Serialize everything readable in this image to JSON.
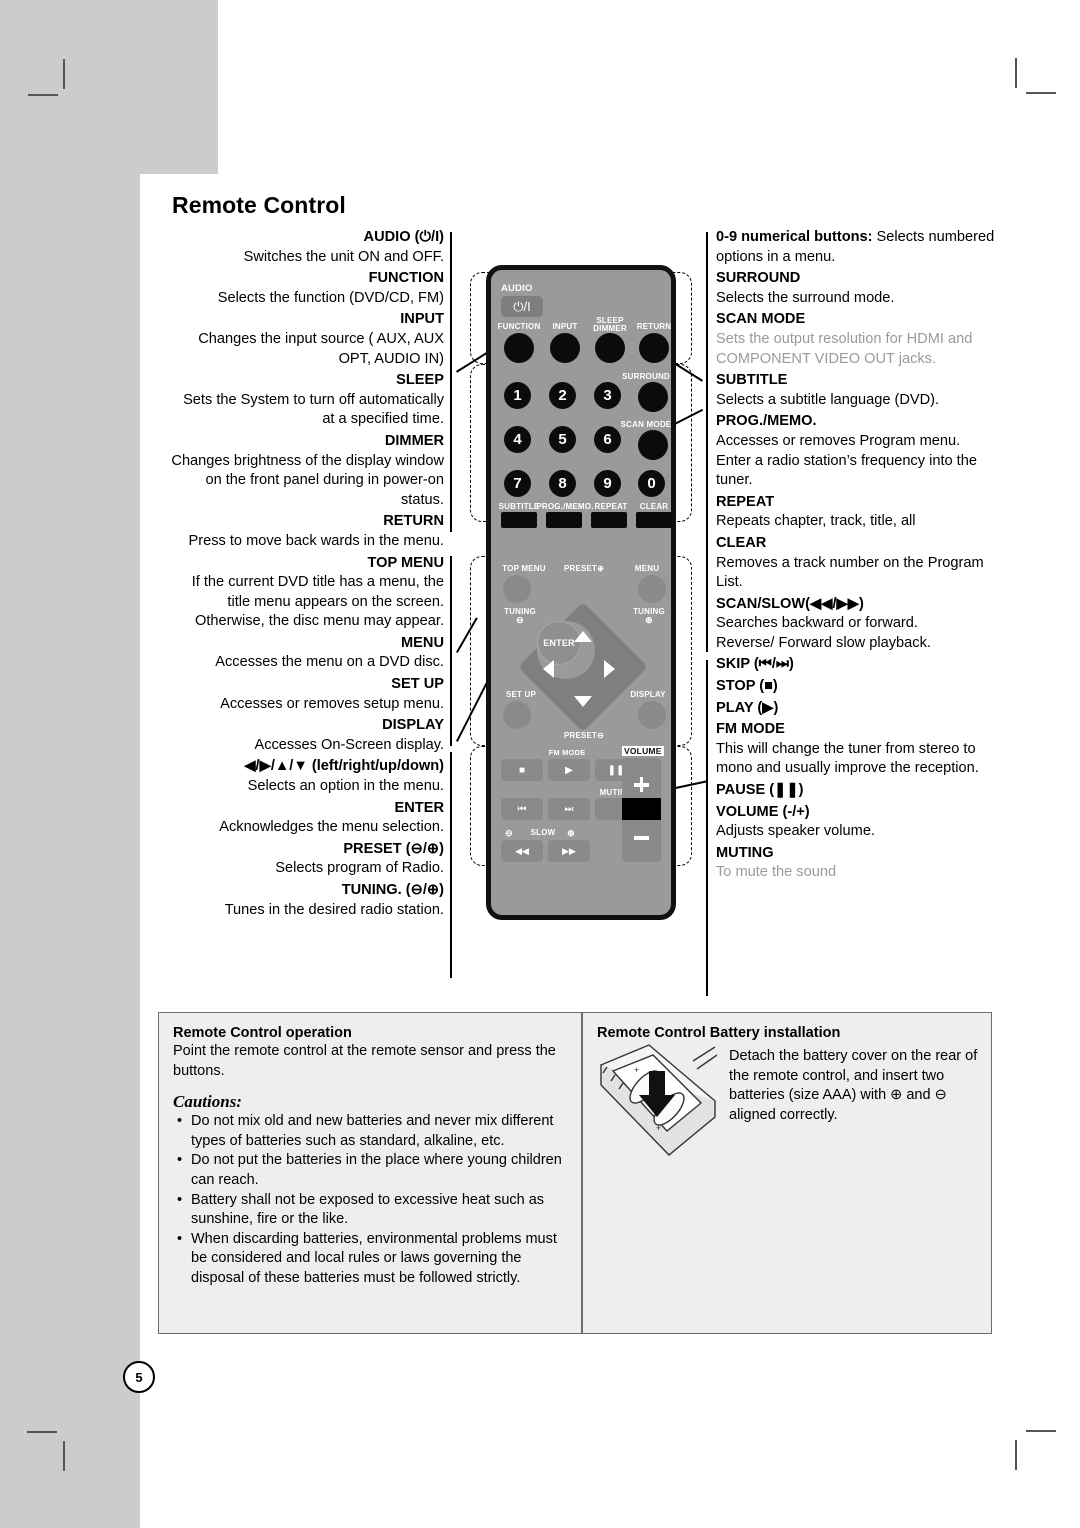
{
  "page": {
    "number": "5"
  },
  "title": "Remote Control",
  "left_column": [
    {
      "head": "AUDIO (⏻/I)",
      "body": "Switches the unit ON and OFF."
    },
    {
      "head": "FUNCTION",
      "body": "Selects the function (DVD/CD, FM)"
    },
    {
      "head": "INPUT",
      "body": "Changes the input source ( AUX, AUX OPT, AUDIO IN)"
    },
    {
      "head": "SLEEP",
      "body": "Sets the System to turn off automatically at a specified time."
    },
    {
      "head": "DIMMER",
      "body": "Changes brightness of the display window on the front panel during in power-on status."
    },
    {
      "head": "RETURN",
      "body": "Press to move back wards in the menu."
    },
    {
      "head": "TOP MENU",
      "body": "If the current DVD title has a menu, the title menu appears on the screen. Otherwise, the disc menu may appear."
    },
    {
      "head": "MENU",
      "body": "Accesses the menu on a DVD disc."
    },
    {
      "head": "SET UP",
      "body": "Accesses or removes setup menu."
    },
    {
      "head": "DISPLAY",
      "body": "Accesses On-Screen display."
    },
    {
      "head": "◀/▶/▲/▼ (left/right/up/down)",
      "body": "Selects an option in the menu."
    },
    {
      "head": "ENTER",
      "body": "Acknowledges the menu selection."
    },
    {
      "head": "PRESET (⊖/⊕)",
      "body": "Selects program of Radio."
    },
    {
      "head": "TUNING. (⊖/⊕)",
      "body": "Tunes in the desired radio station."
    }
  ],
  "right_column": [
    {
      "head": "0-9 numerical buttons:",
      "body": " Selects numbered options in a menu.",
      "inline": true,
      "faded": false
    },
    {
      "head": "SURROUND",
      "body": "Selects the surround mode.",
      "inline": false,
      "faded": false
    },
    {
      "head": "SCAN MODE",
      "body": "Sets the output resolution for HDMI and COMPONENT VIDEO OUT jacks.",
      "inline": false,
      "faded": true
    },
    {
      "head": "SUBTITLE",
      "body": "Selects a subtitle language (DVD).",
      "inline": false,
      "faded": false
    },
    {
      "head": "PROG./MEMO.",
      "body": "Accesses or removes Program menu.\nEnter a radio station’s frequency into the tuner.",
      "inline": false,
      "faded": false
    },
    {
      "head": "REPEAT",
      "body": "Repeats chapter, track, title, all",
      "inline": false,
      "faded": false
    },
    {
      "head": "CLEAR",
      "body": "Removes a track number on the Program List.",
      "inline": false,
      "faded": false
    },
    {
      "head": "SCAN/SLOW(◀◀/▶▶)",
      "body": "Searches backward or forward.\nReverse/ Forward slow playback.",
      "inline": false,
      "faded": false
    },
    {
      "head": "SKIP (⏮/⏭)",
      "body": "",
      "inline": false,
      "faded": false
    },
    {
      "head": "STOP (■)",
      "body": "",
      "inline": false,
      "faded": false
    },
    {
      "head": "PLAY (▶)",
      "body": "",
      "inline": false,
      "faded": false
    },
    {
      "head": "FM MODE",
      "body": "This will change the tuner from stereo to mono and usually improve the reception.",
      "inline": false,
      "faded": false
    },
    {
      "head": "PAUSE (❚❚)",
      "body": "",
      "inline": false,
      "faded": false
    },
    {
      "head": "VOLUME (-/+)",
      "body": "Adjusts speaker volume.",
      "inline": false,
      "faded": false
    },
    {
      "head": "MUTING",
      "body": "To mute the sound",
      "inline": false,
      "faded": true
    }
  ],
  "remote": {
    "labels": {
      "audio": "AUDIO",
      "power": "⏻/I",
      "function": "FUNCTION",
      "input": "INPUT",
      "sleep": "SLEEP",
      "dimmer": "DIMMER",
      "return": "RETURN",
      "surround": "SURROUND",
      "scan_mode": "SCAN MODE",
      "subtitle": "SUBTITLE",
      "prog_memo": "PROG./MEMO.",
      "repeat": "REPEAT",
      "clear": "CLEAR",
      "top_menu": "TOP MENU",
      "preset_up": "PRESET",
      "preset_up_sign": "⊕",
      "menu": "MENU",
      "tuning_minus": "TUNING",
      "tuning_minus_sign": "⊖",
      "tuning_plus": "TUNING",
      "tuning_plus_sign": "⊕",
      "enter": "ENTER",
      "set_up": "SET UP",
      "display": "DISPLAY",
      "preset_down": "PRESET",
      "preset_down_sign": "⊖",
      "fm_mode": "FM MODE",
      "volume": "VOLUME",
      "muting": "MUTING",
      "slow": "SLOW",
      "slow_minus": "⊖",
      "slow_plus": "⊕"
    },
    "numbers": [
      "1",
      "2",
      "3",
      "4",
      "5",
      "6",
      "7",
      "8",
      "9",
      "0"
    ],
    "transport": {
      "stop": "■",
      "play": "▶",
      "pause": "❚❚",
      "skip_back": "⏮",
      "skip_fwd": "⏭",
      "scan_back": "◀◀",
      "scan_fwd": "▶▶"
    },
    "colors": {
      "body": "#9a9a9a",
      "button": "#0b0b0b",
      "outline": "#111111"
    }
  },
  "bottom_left": {
    "title": "Remote Control operation",
    "text": "Point the remote control at the remote sensor and press the buttons.",
    "cautions_label": "Cautions:",
    "cautions": [
      "Do not mix old and new batteries and never mix different types of batteries such as standard, alkaline, etc.",
      "Do not put the batteries in the place where young children can reach.",
      "Battery shall not be exposed to excessive heat such as sunshine, fire or the like.",
      "When discarding batteries, environmental problems must be considered and local rules or laws governing the disposal of these batteries must be followed strictly."
    ]
  },
  "bottom_right": {
    "title": "Remote Control Battery installation",
    "text": "Detach the battery cover on the rear of the remote control, and insert two batteries (size AAA) with ⊕ and ⊖ aligned correctly."
  }
}
